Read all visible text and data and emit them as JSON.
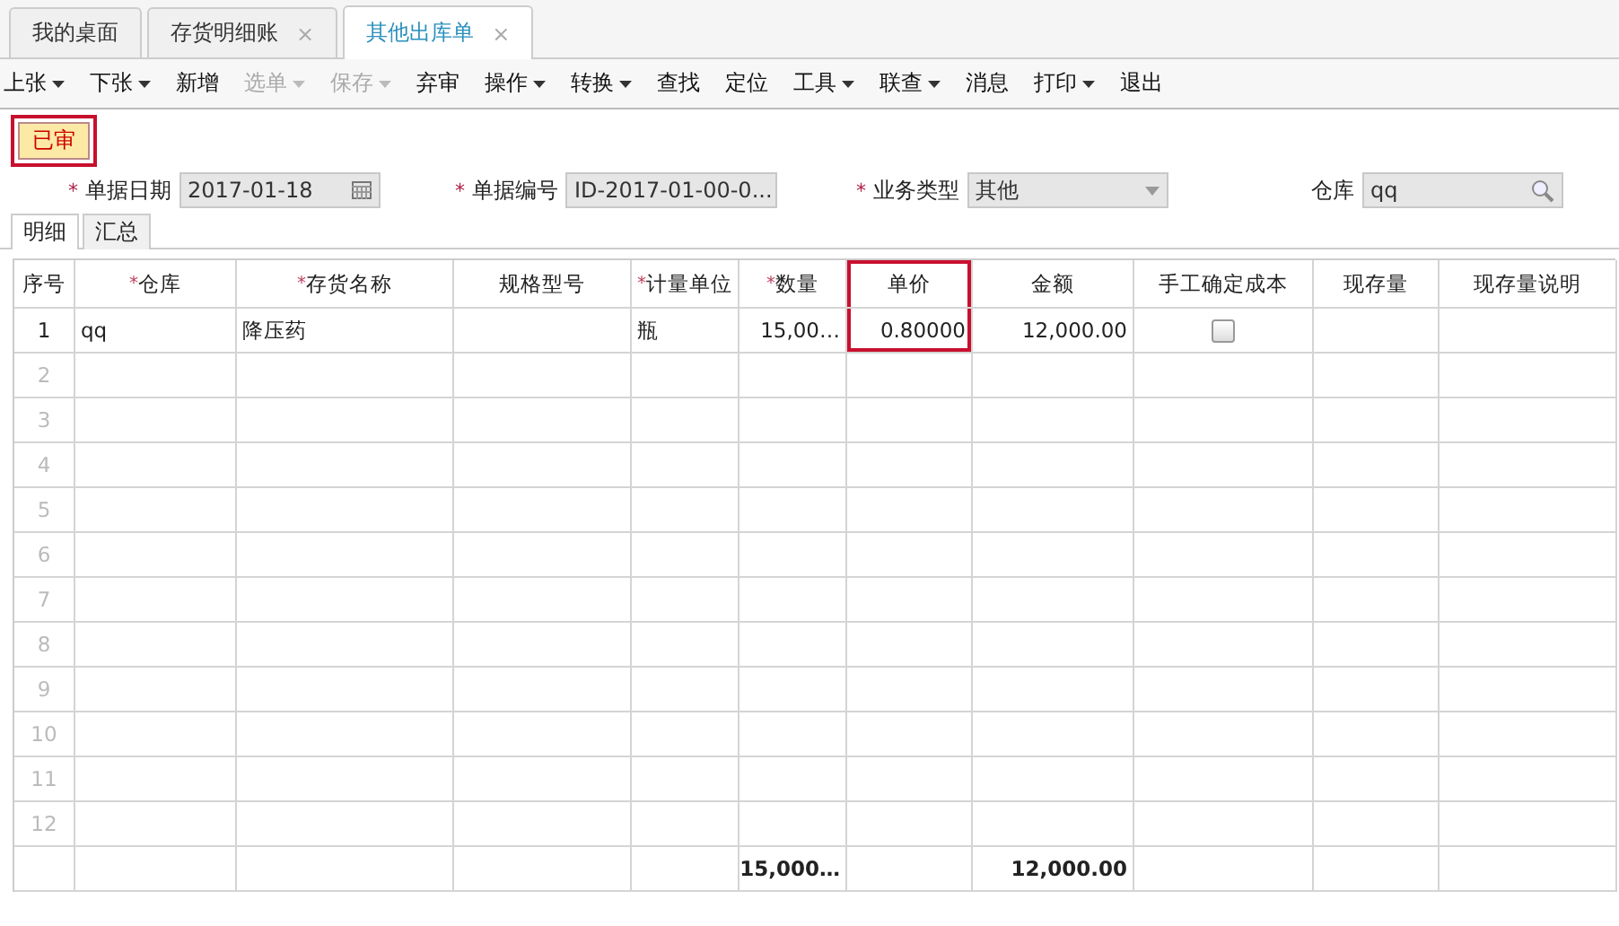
{
  "tabs": [
    {
      "label": "我的桌面",
      "selected": false
    },
    {
      "label": "存货明细账",
      "selected": false,
      "close": "×"
    },
    {
      "label": "其他出库单",
      "selected": true,
      "close": "×"
    }
  ],
  "toolbar": [
    {
      "label": "上张",
      "dropdown": true,
      "disabled": false
    },
    {
      "label": "下张",
      "dropdown": true,
      "disabled": false
    },
    {
      "label": "新增",
      "dropdown": false,
      "disabled": false
    },
    {
      "label": "选单",
      "dropdown": true,
      "disabled": true
    },
    {
      "label": "保存",
      "dropdown": true,
      "disabled": true
    },
    {
      "label": "弃审",
      "dropdown": false,
      "disabled": false
    },
    {
      "label": "操作",
      "dropdown": true,
      "disabled": false
    },
    {
      "label": "转换",
      "dropdown": true,
      "disabled": false
    },
    {
      "label": "查找",
      "dropdown": false,
      "disabled": false
    },
    {
      "label": "定位",
      "dropdown": false,
      "disabled": false
    },
    {
      "label": "工具",
      "dropdown": true,
      "disabled": false
    },
    {
      "label": "联查",
      "dropdown": true,
      "disabled": false
    },
    {
      "label": "消息",
      "dropdown": false,
      "disabled": false
    },
    {
      "label": "打印",
      "dropdown": true,
      "disabled": false
    },
    {
      "label": "退出",
      "dropdown": false,
      "disabled": false
    }
  ],
  "status_badge": {
    "label": "已审",
    "highlighted": true
  },
  "fields": [
    {
      "kind": "date",
      "mark": "*",
      "label": "单据日期",
      "value": "2017-01-18"
    },
    {
      "kind": "text",
      "mark": "*",
      "label": "单据编号",
      "value": "ID-2017-01-00-0..."
    },
    {
      "kind": "select",
      "mark": "*",
      "label": "业务类型",
      "value": "其他"
    },
    {
      "kind": "lookup",
      "label": "仓库",
      "value": "qq"
    }
  ],
  "sub_tabs": [
    {
      "label": "明细",
      "selected": true
    },
    {
      "label": "汇总",
      "selected": false
    }
  ],
  "table": {
    "columns": [
      {
        "label": "序号",
        "highlighted": false
      },
      {
        "mark": "*",
        "label": "仓库",
        "highlighted": false
      },
      {
        "mark": "*",
        "label": "存货名称",
        "highlighted": false
      },
      {
        "label": "规格型号",
        "highlighted": false
      },
      {
        "mark": "*",
        "label": "计量单位",
        "highlighted": false
      },
      {
        "mark": "*",
        "label": "数量",
        "highlighted": false
      },
      {
        "label": "单价",
        "highlighted": true
      },
      {
        "label": "金额",
        "highlighted": false
      },
      {
        "label": "手工确定成本",
        "highlighted": false
      },
      {
        "label": "现存量",
        "highlighted": false
      },
      {
        "label": "现存量说明",
        "highlighted": false
      }
    ],
    "rows": [
      {
        "cells": [
          "1",
          "qq",
          "降压药",
          null,
          "瓶",
          "15,00…",
          "0.80000",
          "12,000.00"
        ],
        "manual_cost_checked": false
      },
      {
        "cells": [
          "2"
        ]
      },
      {
        "cells": [
          "3"
        ]
      },
      {
        "cells": [
          "4"
        ]
      },
      {
        "cells": [
          "5"
        ]
      },
      {
        "cells": [
          "6"
        ]
      },
      {
        "cells": [
          "7"
        ]
      },
      {
        "cells": [
          "8"
        ]
      },
      {
        "cells": [
          "9"
        ]
      },
      {
        "cells": [
          "10"
        ]
      },
      {
        "cells": [
          "11"
        ]
      },
      {
        "cells": [
          "12"
        ]
      }
    ],
    "totals": {
      "quantity": "15,000…",
      "amount": "12,000.00"
    }
  }
}
